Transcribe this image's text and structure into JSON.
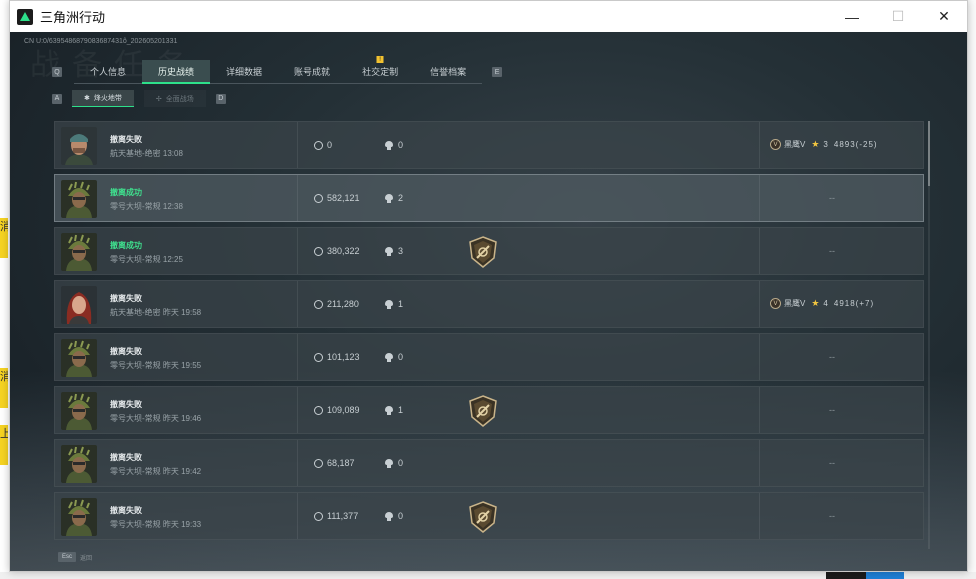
{
  "window": {
    "title": "三角洲行动",
    "controls": {
      "minimize": "—",
      "maximize": "☐",
      "close": "✕"
    }
  },
  "uid_line": "CN U:0/6395486879083687431ô_202605201331",
  "watermark": "战备任务",
  "tabs": {
    "left_key": "Q",
    "right_key": "E",
    "items": [
      {
        "label": "个人信息",
        "active": false
      },
      {
        "label": "历史战绩",
        "active": true
      },
      {
        "label": "详细数据",
        "active": false
      },
      {
        "label": "账号成就",
        "active": false
      },
      {
        "label": "社交定制",
        "active": false,
        "badge": "!"
      },
      {
        "label": "信誉档案",
        "active": false
      }
    ]
  },
  "subtabs": {
    "left_key": "A",
    "right_key": "D",
    "items": [
      {
        "label": "烽火地带",
        "active": true
      },
      {
        "label": "全面战场",
        "active": false
      }
    ]
  },
  "matches": [
    {
      "status": "撤离失败",
      "success": false,
      "map": "航天基地-绝密 13:08",
      "money": "0",
      "kills": "0",
      "badge": false,
      "rank": {
        "tier": "黑鹰V",
        "stars": "3",
        "score": "4893(-25)"
      },
      "avatar": "soldier-cap",
      "highlight": false
    },
    {
      "status": "撤离成功",
      "success": true,
      "map": "零号大坝-常规 12:38",
      "money": "582,121",
      "kills": "2",
      "badge": false,
      "rank": null,
      "dash": "--",
      "avatar": "ghillie",
      "highlight": true
    },
    {
      "status": "撤离成功",
      "success": true,
      "map": "零号大坝-常规 12:25",
      "money": "380,322",
      "kills": "3",
      "badge": true,
      "rank": null,
      "dash": "--",
      "avatar": "ghillie",
      "highlight": false
    },
    {
      "status": "撤离失败",
      "success": false,
      "map": "航天基地-绝密 昨天 19:58",
      "money": "211,280",
      "kills": "1",
      "badge": false,
      "rank": {
        "tier": "黑鹰V",
        "stars": "4",
        "score": "4918(+7)"
      },
      "avatar": "redhair",
      "highlight": false
    },
    {
      "status": "撤离失败",
      "success": false,
      "map": "零号大坝-常规 昨天 19:55",
      "money": "101,123",
      "kills": "0",
      "badge": false,
      "rank": null,
      "dash": "--",
      "avatar": "ghillie",
      "highlight": false
    },
    {
      "status": "撤离失败",
      "success": false,
      "map": "零号大坝-常规 昨天 19:46",
      "money": "109,089",
      "kills": "1",
      "badge": true,
      "rank": null,
      "dash": "--",
      "avatar": "ghillie",
      "highlight": false
    },
    {
      "status": "撤离失败",
      "success": false,
      "map": "零号大坝-常规 昨天 19:42",
      "money": "68,187",
      "kills": "0",
      "badge": false,
      "rank": null,
      "dash": "--",
      "avatar": "ghillie",
      "highlight": false
    },
    {
      "status": "撤离失败",
      "success": false,
      "map": "零号大坝-常规 昨天 19:33",
      "money": "111,377",
      "kills": "0",
      "badge": true,
      "rank": null,
      "dash": "--",
      "avatar": "ghillie",
      "highlight": false
    }
  ],
  "footer": {
    "key": "Esc",
    "label": "返回"
  },
  "colors": {
    "accent": "#2de08a",
    "success": "#3fe08e",
    "gold": "#f1c540"
  }
}
